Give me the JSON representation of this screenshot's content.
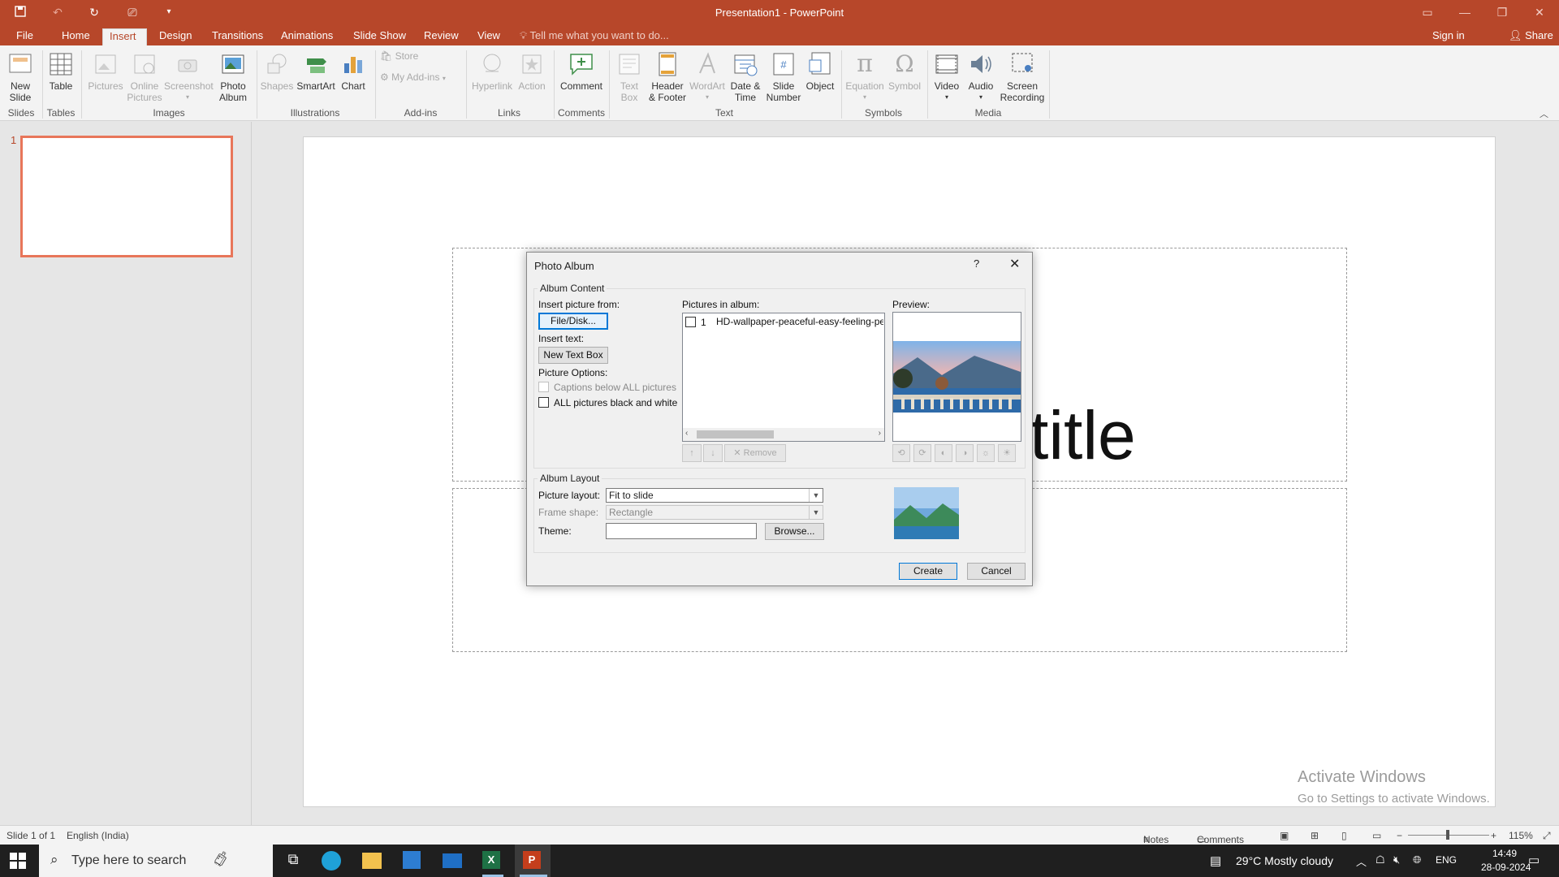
{
  "window": {
    "title": "Presentation1 - PowerPoint"
  },
  "tabs": [
    "File",
    "Home",
    "Insert",
    "Design",
    "Transitions",
    "Animations",
    "Slide Show",
    "Review",
    "View"
  ],
  "tell_me": "Tell me what you want to do...",
  "sign_in": "Sign in",
  "share": "Share",
  "ribbon": {
    "new_slide": [
      "New",
      "Slide"
    ],
    "table": "Table",
    "pictures": "Pictures",
    "online_pictures": [
      "Online",
      "Pictures"
    ],
    "screenshot": "Screenshot",
    "photo_album": [
      "Photo",
      "Album"
    ],
    "shapes": "Shapes",
    "smartart": "SmartArt",
    "chart": "Chart",
    "store": "Store",
    "my_addins": "My Add-ins",
    "hyperlink": "Hyperlink",
    "action": "Action",
    "comment": "Comment",
    "text_box": [
      "Text",
      "Box"
    ],
    "header_footer": [
      "Header",
      "& Footer"
    ],
    "wordart": "WordArt",
    "date_time": [
      "Date &",
      "Time"
    ],
    "slide_number": [
      "Slide",
      "Number"
    ],
    "object": "Object",
    "equation": "Equation",
    "symbol": "Symbol",
    "video": "Video",
    "audio": "Audio",
    "screen_recording": [
      "Screen",
      "Recording"
    ],
    "groups": {
      "slides": "Slides",
      "tables": "Tables",
      "images": "Images",
      "illustrations": "Illustrations",
      "addins": "Add-ins",
      "links": "Links",
      "comments": "Comments",
      "text": "Text",
      "symbols": "Symbols",
      "media": "Media"
    }
  },
  "thumbnail": {
    "number": "1"
  },
  "slide": {
    "title_fragment": "title"
  },
  "dialog": {
    "title": "Photo Album",
    "album_content": "Album Content",
    "insert_picture_from": "Insert picture from:",
    "file_disk": "File/Disk...",
    "insert_text": "Insert text:",
    "new_text_box": "New Text Box",
    "picture_options": "Picture Options:",
    "captions_below": "Captions below ALL pictures",
    "black_and_white": "ALL pictures black and white",
    "pictures_in_album": "Pictures in album:",
    "album_items": [
      {
        "index": "1",
        "name": "HD-wallpaper-peaceful-easy-feeling-pea"
      }
    ],
    "remove": "Remove",
    "preview": "Preview:",
    "album_layout": "Album Layout",
    "picture_layout_label": "Picture layout:",
    "picture_layout_value": "Fit to slide",
    "frame_shape_label": "Frame shape:",
    "frame_shape_value": "Rectangle",
    "theme_label": "Theme:",
    "theme_value": "",
    "browse": "Browse...",
    "create": "Create",
    "cancel": "Cancel"
  },
  "watermark": {
    "line1": "Activate Windows",
    "line2": "Go to Settings to activate Windows."
  },
  "status": {
    "slide_of": "Slide 1 of 1",
    "language": "English (India)",
    "notes": "Notes",
    "comments": "Comments",
    "zoom": "115%"
  },
  "taskbar": {
    "search_placeholder": "Type here to search",
    "weather": "29°C  Mostly cloudy",
    "lang": "ENG",
    "time": "14:49",
    "date": "28-09-2024"
  },
  "colors": {
    "accent": "#b7472a",
    "thumb_border": "#e8765a",
    "focus": "#0078d7"
  }
}
